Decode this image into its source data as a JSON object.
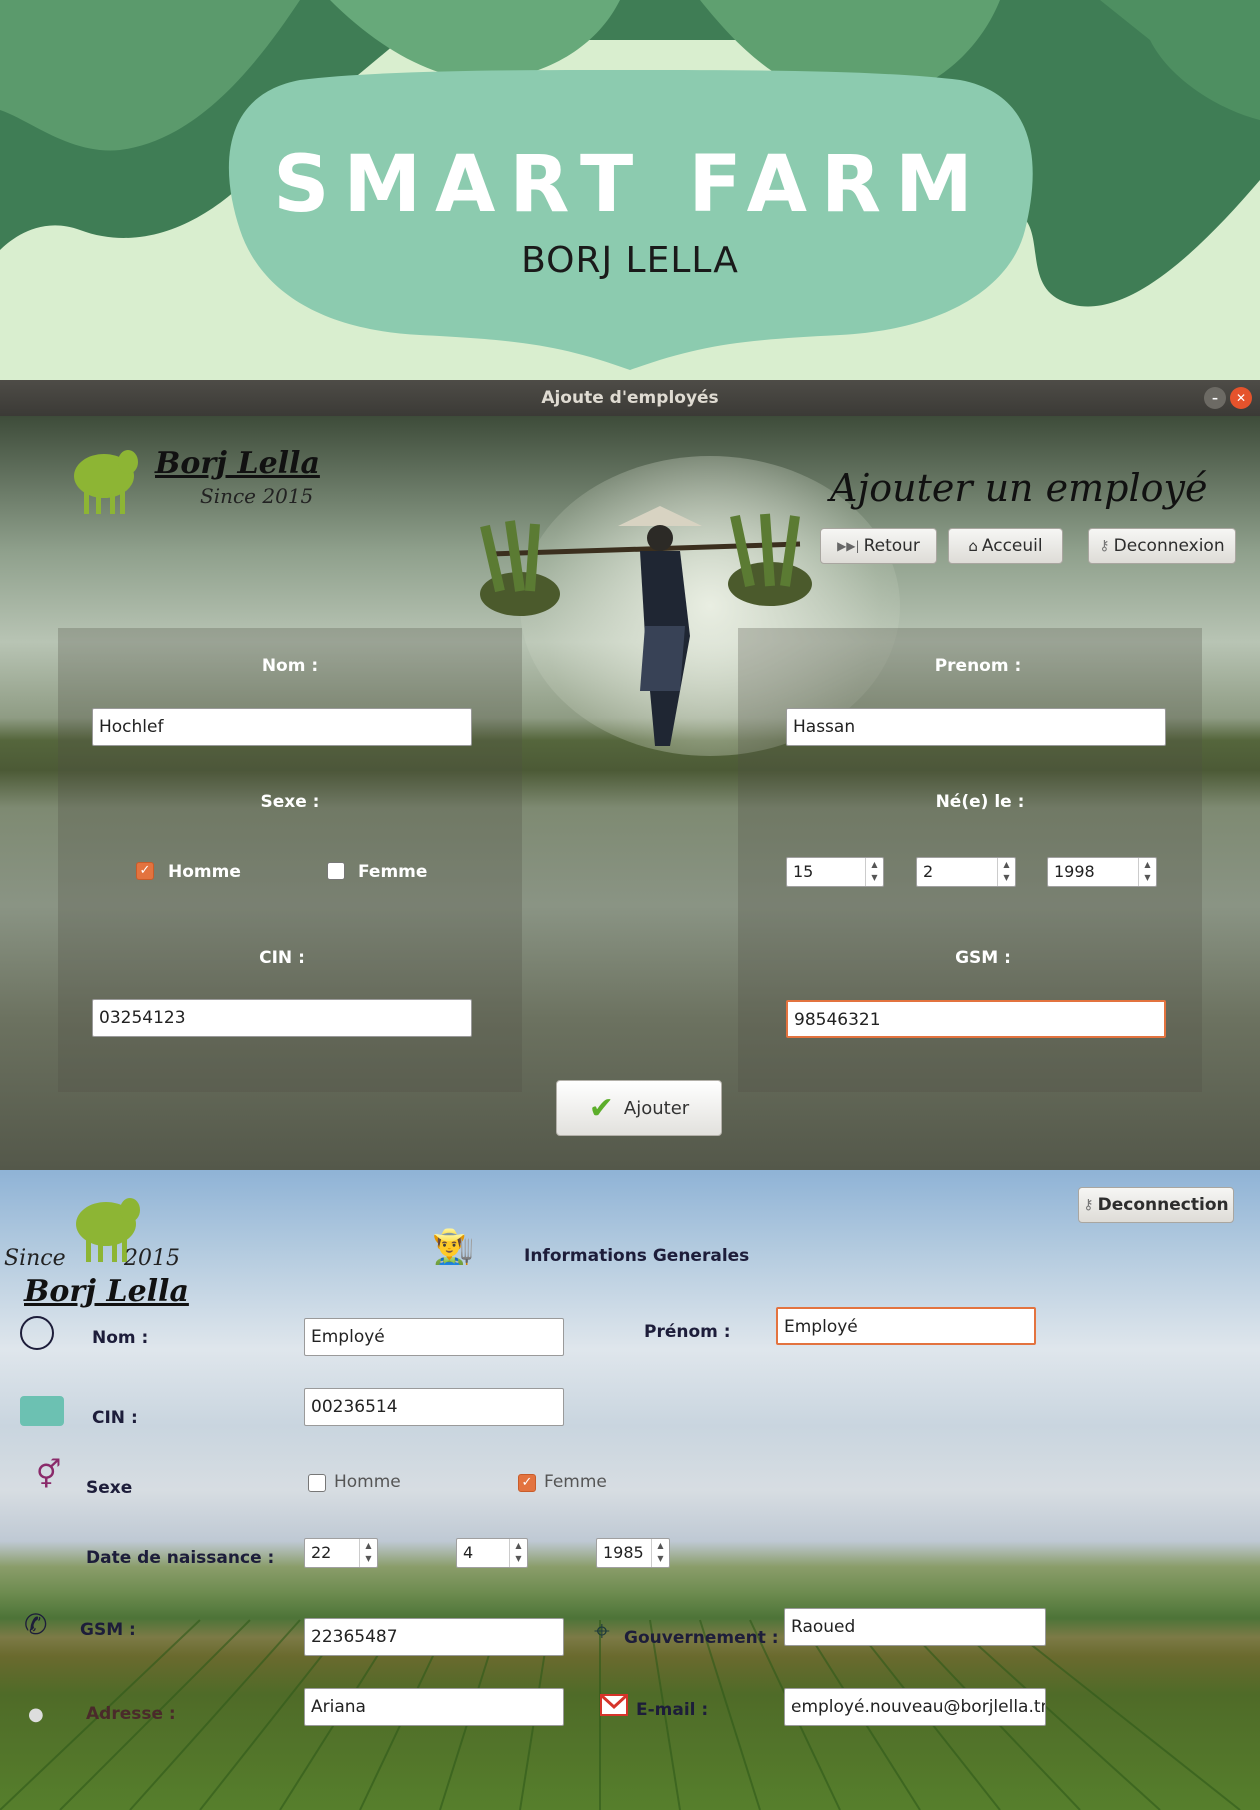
{
  "banner": {
    "title": "SMART FARM",
    "subtitle": "BORJ LELLA"
  },
  "window1": {
    "title": "Ajoute d'employés",
    "brand_name": "Borj Lella",
    "brand_since": "Since 2015",
    "heading": "Ajouter un employé",
    "nav": {
      "retour": "Retour",
      "acceuil": "Acceuil",
      "deconnexion": "Deconnexion"
    },
    "form": {
      "nom_label": "Nom :",
      "nom_value": "Hochlef",
      "prenom_label": "Prenom :",
      "prenom_value": "Hassan",
      "sexe_label": "Sexe :",
      "homme_label": "Homme",
      "femme_label": "Femme",
      "homme_checked": true,
      "femme_checked": false,
      "ne_label": "Né(e) le :",
      "day": "15",
      "month": "2",
      "year": "1998",
      "cin_label": "CIN :",
      "cin_value": "03254123",
      "gsm_label": "GSM :",
      "gsm_value": "98546321"
    },
    "submit_label": "Ajouter"
  },
  "window2": {
    "deconnection_label": "Deconnection",
    "brand_since_left": "Since",
    "brand_since_right": "2015",
    "brand_name": "Borj Lella",
    "section_title": "Informations Generales",
    "fields": {
      "nom_label": "Nom :",
      "nom_value": "Employé",
      "prenom_label": "Prénom :",
      "prenom_value": "Employé",
      "cin_label": "CIN :",
      "cin_value": "00236514",
      "sexe_label": "Sexe",
      "homme_label": "Homme",
      "femme_label": "Femme",
      "homme_checked": false,
      "femme_checked": true,
      "dob_label": "Date de naissance :",
      "day": "22",
      "month": "4",
      "year": "1985",
      "gsm_label": "GSM :",
      "gsm_value": "22365487",
      "gouvernement_label": "Gouvernement :",
      "gouvernement_value": "Raoued",
      "adresse_label": "Adresse :",
      "adresse_value": "Ariana",
      "email_label": "E-mail :",
      "email_value": "employé.nouveau@borjlella.tn"
    }
  },
  "colors": {
    "accent": "#e3733f",
    "banner_green": "#8ccbaf",
    "dark_green": "#3f7d55"
  }
}
